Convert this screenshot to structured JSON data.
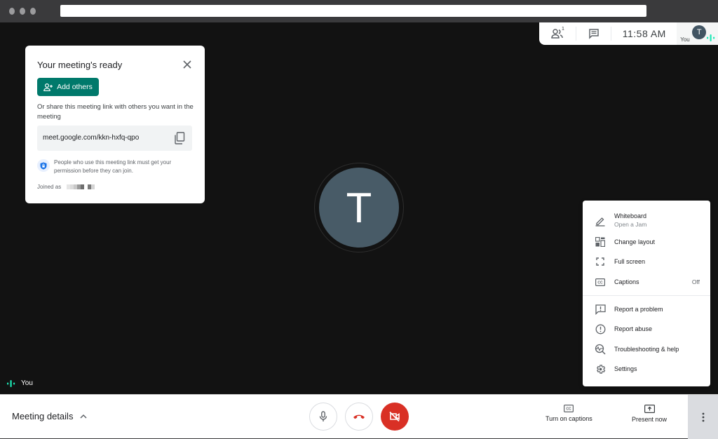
{
  "browser": {
    "window_dots": 3,
    "url": ""
  },
  "top_panel": {
    "participants_icon": "people-icon",
    "participants_count": "1",
    "chat_icon": "chat-icon",
    "time": "11:58  AM",
    "self_label": "You",
    "self_initial": "T"
  },
  "meeting_card": {
    "title": "Your meeting's ready",
    "add_others_label": "Add others",
    "share_text": "Or share this meeting link with others you want in the meeting",
    "link": "meet.google.com/kkn-hxfq-qpo",
    "permission_text": "People who use this meeting link must get your permission before they can join.",
    "joined_as_label": "Joined as",
    "joined_as_name": "(redacted)"
  },
  "stage": {
    "main_initial": "T",
    "self_label": "You"
  },
  "menu": {
    "items": [
      {
        "label": "Whiteboard",
        "sub": "Open a Jam",
        "icon": "pencil-icon",
        "right": ""
      },
      {
        "label": "Change layout",
        "sub": "",
        "icon": "layout-icon",
        "right": ""
      },
      {
        "label": "Full screen",
        "sub": "",
        "icon": "fullscreen-icon",
        "right": ""
      },
      {
        "label": "Captions",
        "sub": "",
        "icon": "captions-icon",
        "right": "Off"
      },
      {
        "label": "Report a problem",
        "sub": "",
        "icon": "report-problem-icon",
        "right": ""
      },
      {
        "label": "Report abuse",
        "sub": "",
        "icon": "report-abuse-icon",
        "right": ""
      },
      {
        "label": "Troubleshooting & help",
        "sub": "",
        "icon": "troubleshoot-icon",
        "right": ""
      },
      {
        "label": "Settings",
        "sub": "",
        "icon": "settings-icon",
        "right": ""
      }
    ]
  },
  "bottom_bar": {
    "meeting_details_label": "Meeting details",
    "captions_label": "Turn on captions",
    "present_label": "Present now"
  },
  "colors": {
    "accent": "#00796b",
    "danger": "#d93025",
    "avatar": "#485b67",
    "audio_indicator": "#1de9b6"
  }
}
